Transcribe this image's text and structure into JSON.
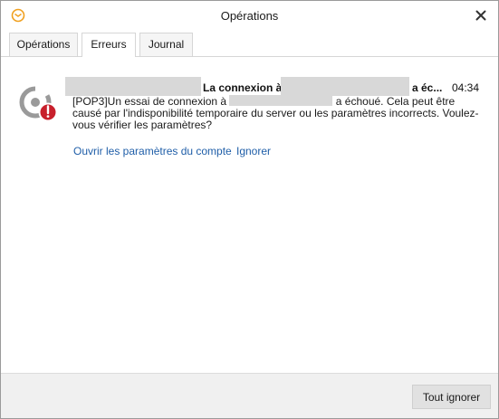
{
  "window": {
    "title": "Opérations",
    "icon": "mail-app-icon",
    "close_icon": "close-icon"
  },
  "tabs": [
    {
      "label": "Opérations",
      "active": false
    },
    {
      "label": "Erreurs",
      "active": true
    },
    {
      "label": "Journal",
      "active": false
    }
  ],
  "error": {
    "icon": "sync-error-icon",
    "title_start": "La connexion à",
    "title_end": "a éc...",
    "time": "04:34",
    "body_start": "[POP3]Un essai de connexion à",
    "body_end": "a échoué. Cela peut être causé par l'indisponibilité temporaire du server ou les paramètres incorrects. Voulez-vous vérifier les paramètres?",
    "link_open_settings": "Ouvrir les paramètres du compte",
    "link_ignore": "Ignorer"
  },
  "footer": {
    "ignore_all_label": "Tout ignorer"
  },
  "colors": {
    "link": "#1f5ea8",
    "error_badge": "#c8202c",
    "icon_grey": "#9a9a9a",
    "app_icon": "#f0a020"
  }
}
